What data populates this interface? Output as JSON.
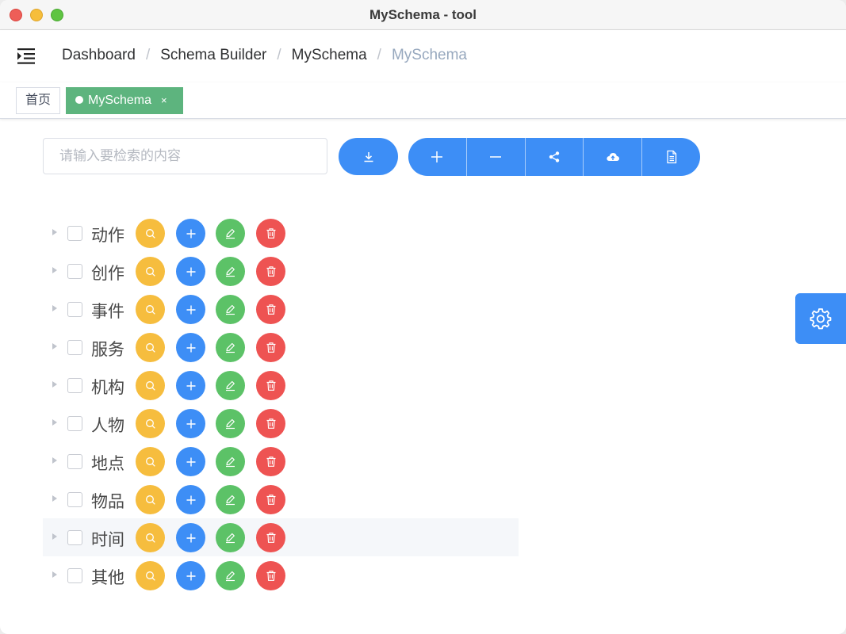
{
  "window": {
    "title": "MySchema - tool"
  },
  "header": {
    "breadcrumb": [
      "Dashboard",
      "Schema Builder",
      "MySchema",
      "MySchema"
    ]
  },
  "tags": {
    "home": "首页",
    "active": "MySchema",
    "close": "×"
  },
  "toolbar": {
    "search_placeholder": "请输入要检索的内容",
    "download_icon": "download-icon",
    "group_icons": [
      "plus-icon",
      "minus-icon",
      "share-icon",
      "cloud-upload-icon",
      "document-icon"
    ]
  },
  "tree": {
    "nodes": [
      {
        "label": "动作"
      },
      {
        "label": "创作"
      },
      {
        "label": "事件"
      },
      {
        "label": "服务"
      },
      {
        "label": "机构"
      },
      {
        "label": "人物"
      },
      {
        "label": "地点"
      },
      {
        "label": "物品"
      },
      {
        "label": "时间",
        "highlighted": true
      },
      {
        "label": "其他"
      }
    ]
  },
  "colors": {
    "primary": "#3d8ef6",
    "success": "#5cc267",
    "warning": "#f6bd3e",
    "danger": "#ee5352",
    "tag_active": "#5db47e"
  }
}
